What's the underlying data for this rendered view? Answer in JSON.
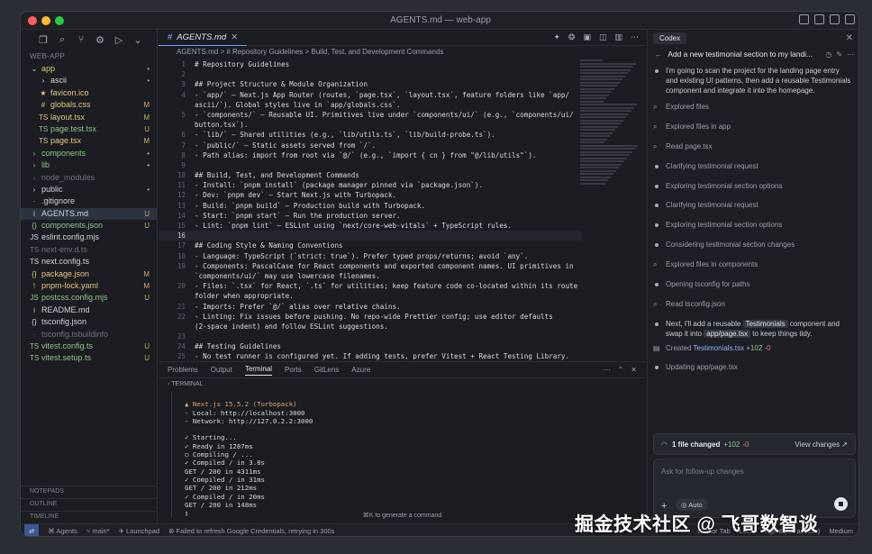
{
  "window": {
    "title": "AGENTS.md — web-app"
  },
  "sidebar": {
    "section": "WEB-APP",
    "items": [
      {
        "label": "app",
        "icon": "chevron-down",
        "badge": "•",
        "cls": "yellow"
      },
      {
        "label": "ascii",
        "icon": "chevron-right",
        "badge": "•",
        "cls": "",
        "indent": 1
      },
      {
        "label": "favicon.ico",
        "icon": "star-icon",
        "badge": "",
        "cls": "yellow",
        "indent": 1
      },
      {
        "label": "globals.css",
        "icon": "#",
        "badge": "M",
        "cls": "yellow",
        "indent": 1
      },
      {
        "label": "layout.tsx",
        "icon": "TS",
        "badge": "M",
        "cls": "yellow",
        "indent": 1
      },
      {
        "label": "page.test.tsx",
        "icon": "TS",
        "badge": "U",
        "cls": "green",
        "indent": 1
      },
      {
        "label": "page.tsx",
        "icon": "TS",
        "badge": "M",
        "cls": "yellow",
        "indent": 1
      },
      {
        "label": "components",
        "icon": "chevron-right",
        "badge": "•",
        "cls": "green"
      },
      {
        "label": "lib",
        "icon": "chevron-right",
        "badge": "•",
        "cls": "green"
      },
      {
        "label": "node_modules",
        "icon": "chevron-right",
        "badge": "",
        "cls": "dim"
      },
      {
        "label": "public",
        "icon": "chevron-right",
        "badge": "•",
        "cls": ""
      },
      {
        "label": ".gitignore",
        "icon": "·",
        "badge": "",
        "cls": ""
      },
      {
        "label": "AGENTS.md",
        "icon": "i",
        "badge": "U",
        "cls": "",
        "active": true
      },
      {
        "label": "components.json",
        "icon": "{}",
        "badge": "U",
        "cls": "green"
      },
      {
        "label": "eslint.config.mjs",
        "icon": "JS",
        "badge": "",
        "cls": ""
      },
      {
        "label": "next-env.d.ts",
        "icon": "TS",
        "badge": "",
        "cls": "dim"
      },
      {
        "label": "next.config.ts",
        "icon": "TS",
        "badge": "",
        "cls": ""
      },
      {
        "label": "package.json",
        "icon": "{}",
        "badge": "M",
        "cls": "yellow"
      },
      {
        "label": "pnpm-lock.yaml",
        "icon": "!",
        "badge": "M",
        "cls": "yellow"
      },
      {
        "label": "postcss.config.mjs",
        "icon": "JS",
        "badge": "U",
        "cls": "green"
      },
      {
        "label": "README.md",
        "icon": "i",
        "badge": "",
        "cls": ""
      },
      {
        "label": "tsconfig.json",
        "icon": "{}",
        "badge": "",
        "cls": ""
      },
      {
        "label": "tsconfig.tsbuildinfo",
        "icon": "·",
        "badge": "",
        "cls": "dim"
      },
      {
        "label": "vitest.config.ts",
        "icon": "TS",
        "badge": "U",
        "cls": "green"
      },
      {
        "label": "vitest.setup.ts",
        "icon": "TS",
        "badge": "U",
        "cls": "green"
      }
    ],
    "bottom": [
      "NOTEPADS",
      "OUTLINE",
      "TIMELINE"
    ]
  },
  "editor": {
    "tab": "AGENTS.md",
    "breadcrumb": "AGENTS.md  >  # Repository Guidelines  >  Build, Test, and Development Commands",
    "lines": [
      {
        "n": "1",
        "t": "# Repository Guidelines"
      },
      {
        "n": "2",
        "t": ""
      },
      {
        "n": "3",
        "t": "## Project Structure & Module Organization"
      },
      {
        "n": "4",
        "t": "- `app/` — Next.js App Router (routes, `page.tsx`, `layout.tsx`, feature folders like `app/"
      },
      {
        "n": "",
        "t": "ascii/`). Global styles live in `app/globals.css`."
      },
      {
        "n": "5",
        "t": "- `components/` — Reusable UI. Primitives live under `components/ui/` (e.g., `components/ui/"
      },
      {
        "n": "",
        "t": "button.tsx`)."
      },
      {
        "n": "6",
        "t": "- `lib/` — Shared utilities (e.g., `lib/utils.ts`, `lib/build-probe.ts`)."
      },
      {
        "n": "7",
        "t": "- `public/` — Static assets served from `/`."
      },
      {
        "n": "8",
        "t": "- Path alias: import from root via `@/` (e.g., `import { cn } from \"@/lib/utils\"`)."
      },
      {
        "n": "9",
        "t": ""
      },
      {
        "n": "10",
        "t": "## Build, Test, and Development Commands"
      },
      {
        "n": "11",
        "t": "- Install: `pnpm install` (package manager pinned via `package.json`)."
      },
      {
        "n": "12",
        "t": "- Dev: `pnpm dev` — Start Next.js with Turbopack."
      },
      {
        "n": "13",
        "t": "- Build: `pnpm build` — Production build with Turbopack."
      },
      {
        "n": "14",
        "t": "- Start: `pnpm start` — Run the production server."
      },
      {
        "n": "15",
        "t": "- Lint: `pnpm lint` — ESLint using `next/core-web-vitals` + TypeScript rules."
      },
      {
        "n": "16",
        "t": "",
        "cur": true
      },
      {
        "n": "17",
        "t": "## Coding Style & Naming Conventions"
      },
      {
        "n": "18",
        "t": "- Language: TypeScript (`strict: true`). Prefer typed props/returns; avoid `any`."
      },
      {
        "n": "19",
        "t": "- Components: PascalCase for React components and exported component names. UI primitives in"
      },
      {
        "n": "",
        "t": "`components/ui/` may use lowercase filenames."
      },
      {
        "n": "20",
        "t": "- Files: `.tsx` for React, `.ts` for utilities; keep feature code co-located within its route"
      },
      {
        "n": "",
        "t": "folder when appropriate."
      },
      {
        "n": "21",
        "t": "- Imports: Prefer `@/` alias over relative chains."
      },
      {
        "n": "22",
        "t": "- Linting: Fix issues before pushing. No repo-wide Prettier config; use editor defaults"
      },
      {
        "n": "",
        "t": "(2-space indent) and follow ESLint suggestions."
      },
      {
        "n": "23",
        "t": ""
      },
      {
        "n": "24",
        "t": "## Testing Guidelines"
      },
      {
        "n": "25",
        "t": "- No test runner is configured yet. If adding tests, prefer Vitest + React Testing Library."
      }
    ]
  },
  "terminal": {
    "tabs": [
      "Problems",
      "Output",
      "Terminal",
      "Ports",
      "GitLens",
      "Azure"
    ],
    "active_tab": "Terminal",
    "header": "TERMINAL",
    "lines": [
      {
        "t": "",
        "o": false
      },
      {
        "t": "▲ Next.js 15.5.2 (Turbopack)",
        "o": true
      },
      {
        "t": "- Local:        http://localhost:3000",
        "o": false
      },
      {
        "t": "- Network:      http://127.0.2.2:3000",
        "o": false
      },
      {
        "t": "",
        "o": false
      },
      {
        "t": "✓ Starting...",
        "o": false
      },
      {
        "t": "✓ Ready in 1287ms",
        "o": false
      },
      {
        "t": "○ Compiling / ...",
        "o": false
      },
      {
        "t": "✓ Compiled / in 3.8s",
        "o": false
      },
      {
        "t": "GET / 200 in 4311ms",
        "o": false
      },
      {
        "t": "✓ Compiled / in 31ms",
        "o": false
      },
      {
        "t": "GET / 200 in 212ms",
        "o": false
      },
      {
        "t": "✓ Compiled / in 20ms",
        "o": false
      },
      {
        "t": "GET / 200 in 148ms",
        "o": false
      },
      {
        "t": "▯",
        "o": false
      }
    ],
    "hint": "⌘K to generate a command"
  },
  "codex": {
    "tab": "Codex",
    "task_title": "Add a new testimonial section to my landi...",
    "intro": "I'm going to scan the project for the landing page entry and existing UI patterns, then add a reusable Testimonials component and integrate it into the homepage.",
    "steps": [
      {
        "label": "Explored files",
        "kind": "icon"
      },
      {
        "label": "Explored files in app",
        "kind": "icon"
      },
      {
        "label": "Read page.tsx",
        "kind": "icon"
      },
      {
        "label": "Clarifying testimonial request",
        "kind": "dot"
      },
      {
        "label": "Exploring testimonial section options",
        "kind": "dot"
      },
      {
        "label": "Clarifying testimonial request",
        "kind": "dot"
      },
      {
        "label": "Exploring testimonial section options",
        "kind": "dot"
      },
      {
        "label": "Considering testimonial section changes",
        "kind": "dot"
      },
      {
        "label": "Explored files in components",
        "kind": "icon"
      },
      {
        "label": "Opening tsconfig for paths",
        "kind": "dot"
      },
      {
        "label": "Read tsconfig.json",
        "kind": "icon"
      }
    ],
    "next_msg_a": "Next, I'll add a reusable ",
    "next_chip1": "Testimonials",
    "next_msg_b": " component and swap it into ",
    "next_chip2": "app/page.tsx",
    "next_msg_c": " to keep things tidy.",
    "created_label": "Created",
    "created_file": "Testimonials.tsx",
    "created_plus": "+102",
    "created_minus": "-0",
    "updating": "Updating app/page.tsx",
    "changes_count": "1 file changed",
    "changes_plus": "+102",
    "changes_minus": "-0",
    "view_changes": "View changes ↗",
    "composer_placeholder": "Ask for follow-up changes",
    "auto_label": "Auto"
  },
  "statusbar": {
    "items": [
      "Agents",
      "main*",
      "Launchpad",
      "Failed to refresh Google Credentials, retrying in 300s"
    ],
    "right": [
      "Cursor Tab",
      "Local",
      "Agent (full access)",
      "Medium"
    ]
  },
  "watermark": "掘金技术社区 @ 飞哥数智谈"
}
